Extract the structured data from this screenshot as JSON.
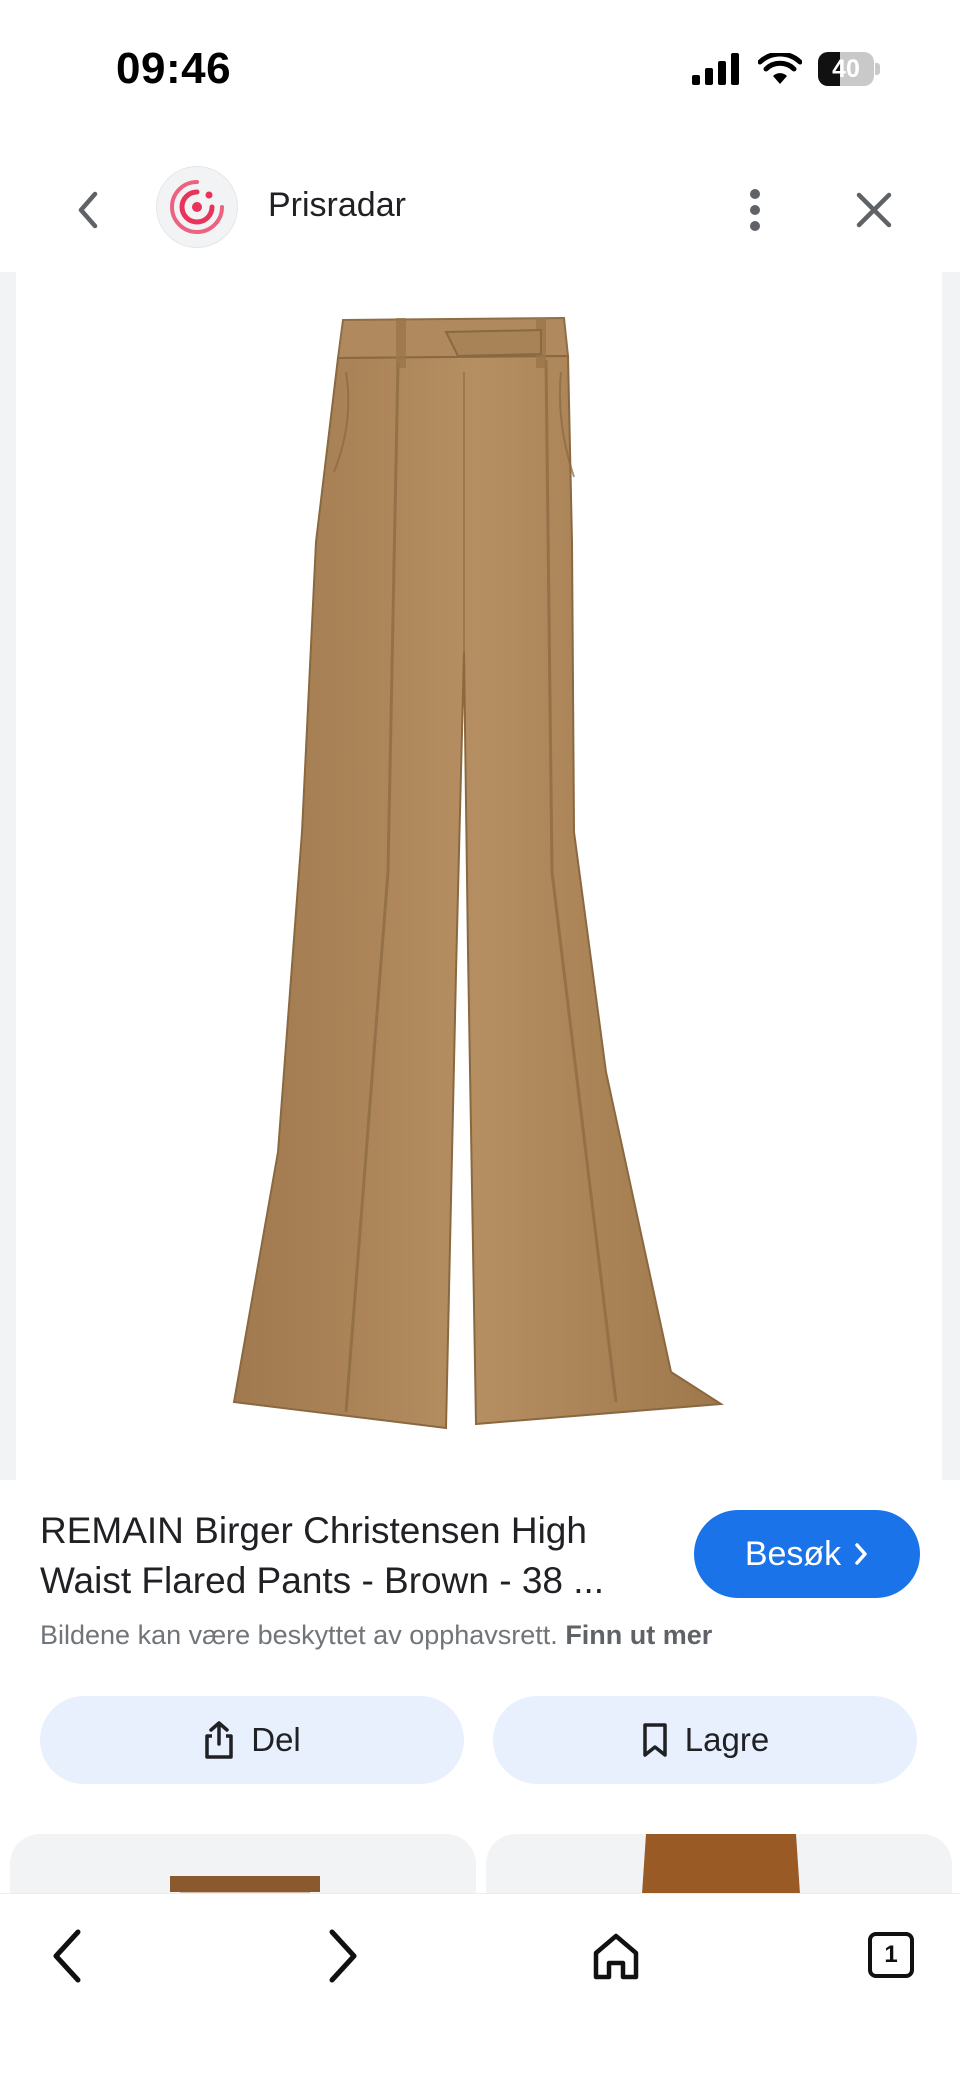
{
  "status_bar": {
    "time": "09:46",
    "battery_level": "40",
    "icons": [
      "signal-icon",
      "wifi-icon",
      "battery-icon"
    ]
  },
  "header": {
    "site_name": "Prisradar",
    "icons": [
      "back-chevron-icon",
      "prisradar-logo",
      "more-vert-icon",
      "close-icon"
    ]
  },
  "product": {
    "title_line1": "REMAIN Birger Christensen High",
    "title_line2": "Waist Flared Pants - Brown - 38 ...",
    "visit_label": "Besøk",
    "copyright_text": "Bildene kan være beskyttet av opphavsrett.",
    "learn_more": "Finn ut mer",
    "image_desc": "brown corduroy high waist flared pants"
  },
  "actions": {
    "share_label": "Del",
    "save_label": "Lagre"
  },
  "bottom_nav": {
    "tab_count": "1",
    "icons": [
      "back-arrow-icon",
      "forward-arrow-icon",
      "home-icon",
      "tabs-icon"
    ]
  },
  "colors": {
    "accent_blue": "#1a73e8",
    "action_bg": "#e8f0fe",
    "logo_red": "#e8335a",
    "pants_brown": "#b08a5e"
  }
}
